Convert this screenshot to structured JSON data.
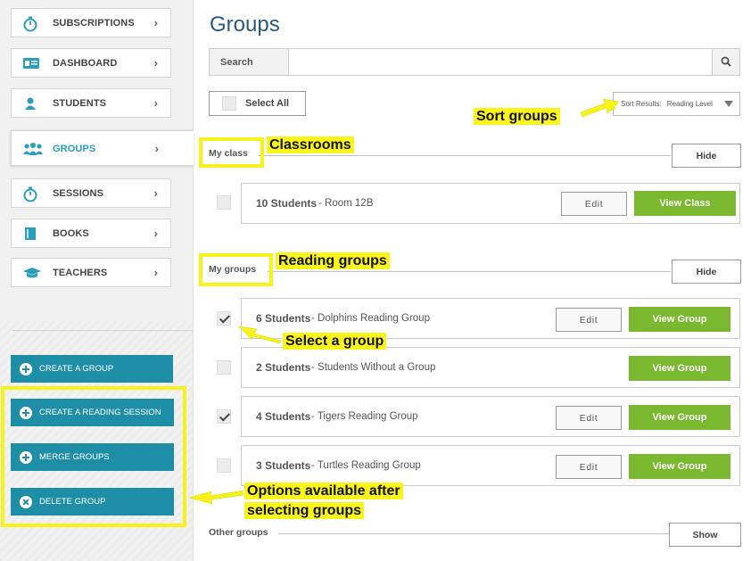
{
  "sidebar": {
    "nav": [
      {
        "label": "SUBSCRIPTIONS",
        "icon": "stopwatch-icon"
      },
      {
        "label": "DASHBOARD",
        "icon": "id-card-icon"
      },
      {
        "label": "STUDENTS",
        "icon": "person-icon"
      },
      {
        "label": "GROUPS",
        "icon": "people-group-icon",
        "active": true
      },
      {
        "label": "SESSIONS",
        "icon": "stopwatch-icon"
      },
      {
        "label": "BOOKS",
        "icon": "book-icon"
      },
      {
        "label": "TEACHERS",
        "icon": "graduation-cap-icon"
      }
    ],
    "chevron": "›",
    "actions": [
      {
        "label": "CREATE A GROUP",
        "icon": "plus-circle-icon"
      },
      {
        "label": "CREATE A READING SESSION",
        "icon": "plus-circle-icon"
      },
      {
        "label": "MERGE GROUPS",
        "icon": "plus-circle-icon"
      },
      {
        "label": "DELETE GROUP",
        "icon": "x-circle-icon"
      }
    ]
  },
  "main": {
    "title": "Groups",
    "search": {
      "tab_label": "Search",
      "value": "",
      "placeholder": ""
    },
    "select_all_label": "Select All",
    "sort": {
      "label": "Sort Results:",
      "value": "Reading Level"
    },
    "sections": {
      "my_class": {
        "label": "My class",
        "toggle": "Hide",
        "rows": [
          {
            "count": "10 Students",
            "name": "Room 12B",
            "checked": false,
            "edit": "Edit",
            "view": "View Class"
          }
        ]
      },
      "my_groups": {
        "label": "My groups",
        "toggle": "Hide",
        "rows": [
          {
            "count": "6 Students",
            "name": "Dolphins Reading Group",
            "checked": true,
            "edit": "Edit",
            "view": "View Group"
          },
          {
            "count": "2 Students",
            "name": "Students Without a Group",
            "checked": false,
            "edit": null,
            "view": "View Group"
          },
          {
            "count": "4 Students",
            "name": "Tigers Reading Group",
            "checked": true,
            "edit": "Edit",
            "view": "View Group"
          },
          {
            "count": "3 Students",
            "name": "Turtles Reading Group",
            "checked": false,
            "edit": "Edit",
            "view": "View Group"
          }
        ]
      },
      "other_groups": {
        "label": "Other groups",
        "toggle": "Show"
      }
    },
    "name_separator": " - "
  },
  "annotations": {
    "sort_groups": "Sort groups",
    "classrooms": "Classrooms",
    "reading_groups": "Reading groups",
    "select_group": "Select a group",
    "options_line1": "Options available after",
    "options_line2": "selecting groups"
  },
  "colors": {
    "accent_blue": "#1e8ea6",
    "title_blue": "#2a5a7f",
    "green": "#7ab92f",
    "highlight_yellow": "#f6f21a"
  }
}
